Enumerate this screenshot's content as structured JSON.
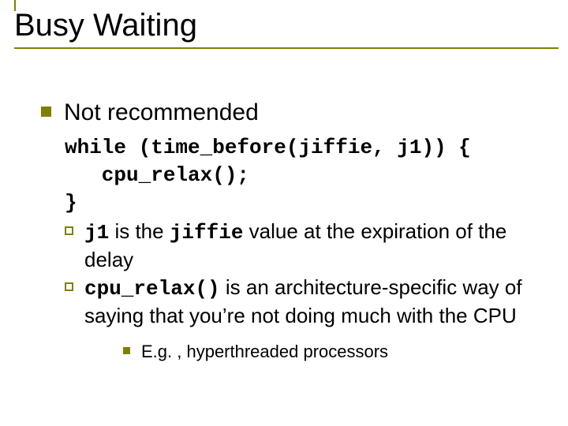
{
  "title": "Busy Waiting",
  "lvl1_text": "Not recommended",
  "code_line1": "while (time_before(jiffie, j1)) {",
  "code_line2": "   cpu_relax();",
  "code_line3": "}",
  "bullet2a_code1": "j1",
  "bullet2a_mid1": " is the ",
  "bullet2a_code2": "jiffie",
  "bullet2a_tail": " value at the expiration of the delay",
  "bullet2b_code": "cpu_relax()",
  "bullet2b_tail": " is an architecture-specific way of saying that you’re not doing much with the CPU",
  "bullet3_text": "E.g. , hyperthreaded processors"
}
